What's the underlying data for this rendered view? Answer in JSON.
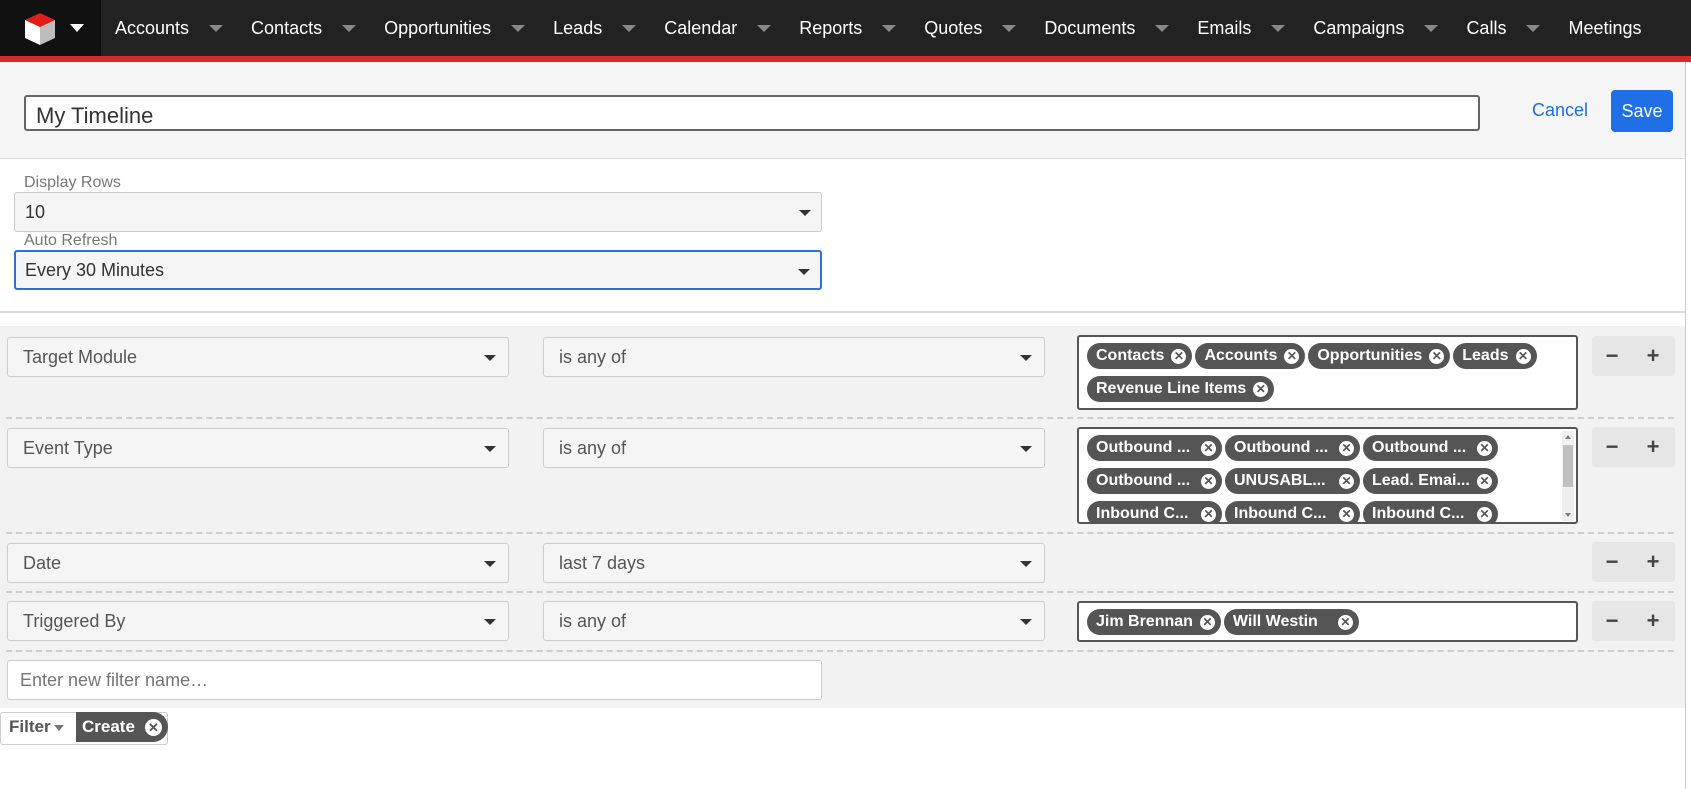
{
  "nav": {
    "items": [
      {
        "label": "Accounts"
      },
      {
        "label": "Contacts"
      },
      {
        "label": "Opportunities"
      },
      {
        "label": "Leads"
      },
      {
        "label": "Calendar"
      },
      {
        "label": "Reports"
      },
      {
        "label": "Quotes"
      },
      {
        "label": "Documents"
      },
      {
        "label": "Emails"
      },
      {
        "label": "Campaigns"
      },
      {
        "label": "Calls"
      },
      {
        "label": "Meetings"
      }
    ]
  },
  "header": {
    "title_value": "My Timeline",
    "cancel_label": "Cancel",
    "save_label": "Save"
  },
  "settings": {
    "display_rows_label": "Display Rows",
    "display_rows_value": "10",
    "auto_refresh_label": "Auto Refresh",
    "auto_refresh_value": "Every 30 Minutes"
  },
  "filters": [
    {
      "field": "Target Module",
      "operator": "is any of",
      "values": [
        "Contacts",
        "Accounts",
        "Opportunities",
        "Leads",
        "Revenue Line Items"
      ]
    },
    {
      "field": "Event Type",
      "operator": "is any of",
      "values": [
        "Outbound ...",
        "Outbound ...",
        "Outbound ...",
        "Outbound ...",
        "UNUSABL...",
        "Lead. Emai...",
        "Inbound C...",
        "Inbound C...",
        "Inbound C..."
      ]
    },
    {
      "field": "Date",
      "operator": "last 7 days",
      "values": []
    },
    {
      "field": "Triggered By",
      "operator": "is any of",
      "values": [
        "Jim Brennan",
        "Will Westin"
      ]
    }
  ],
  "filter_name_placeholder": "Enter new filter name…",
  "filter_bar": {
    "label": "Filter",
    "create_label": "Create"
  },
  "colors": {
    "accent": "#1f6fe6",
    "nav_bg": "#222222",
    "brand_red": "#d52a28",
    "pill_bg": "#555555"
  }
}
